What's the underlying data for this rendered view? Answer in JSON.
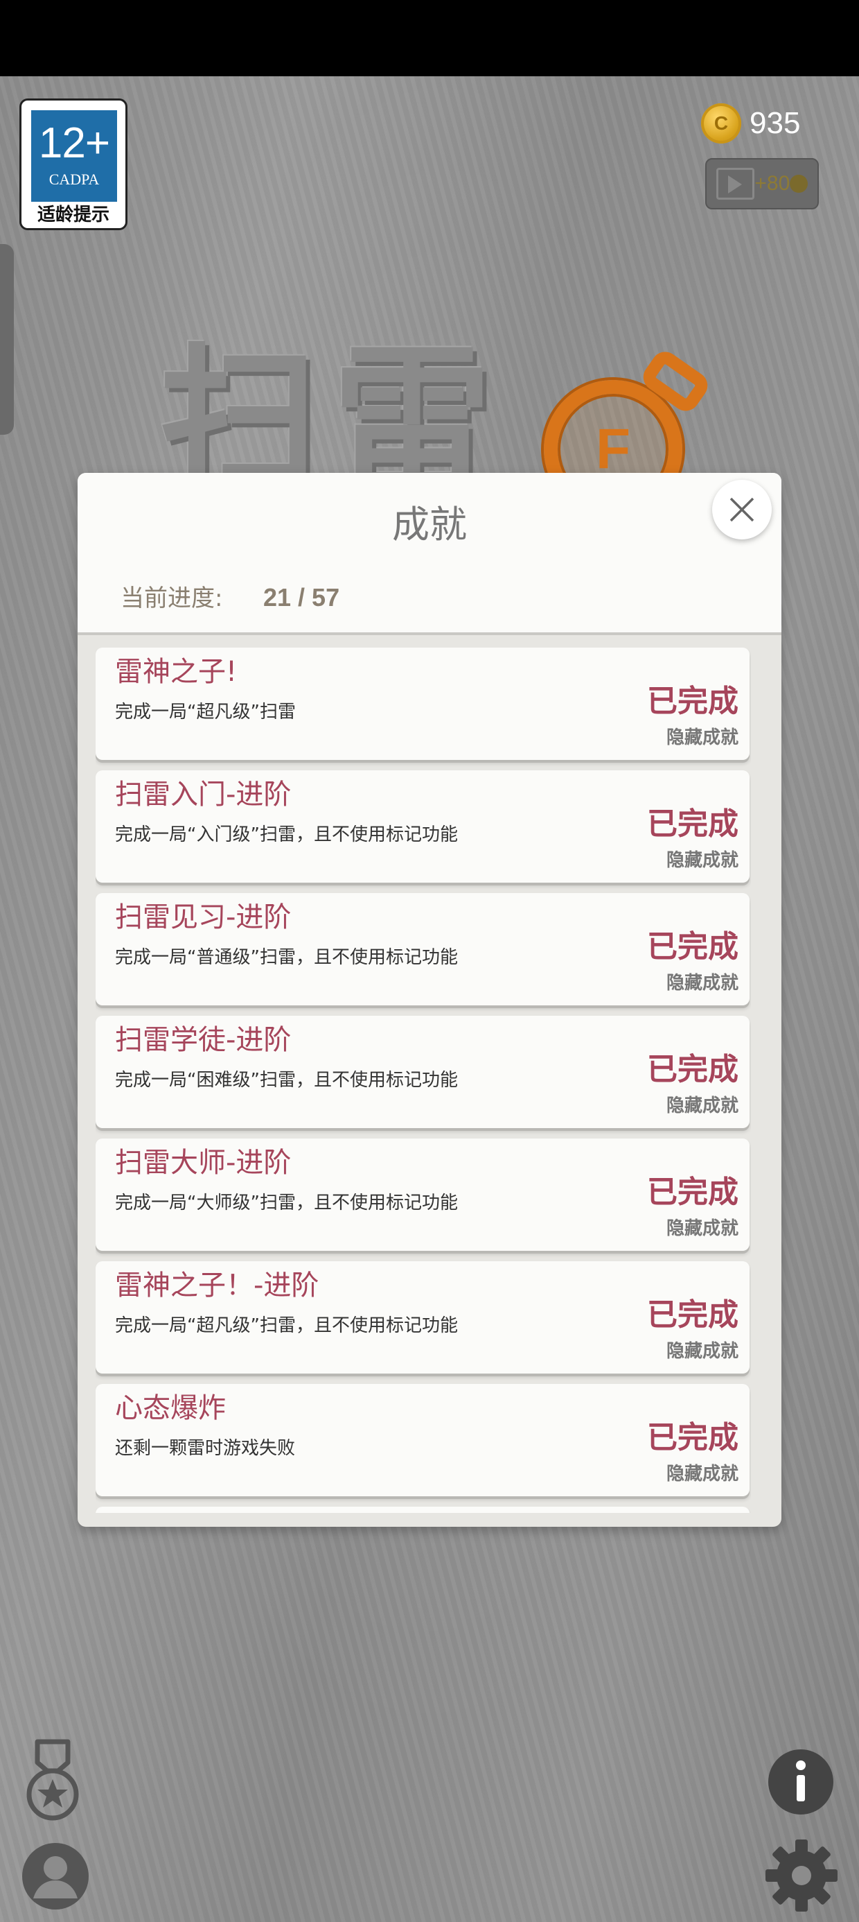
{
  "age_rating": {
    "age": "12+",
    "org": "CADPA",
    "tip": "适龄提示"
  },
  "wallet": {
    "coin_symbol": "C",
    "coins": "935",
    "video_reward": "+80"
  },
  "logo": {
    "title": "扫雷",
    "bomb_letter": "F"
  },
  "dialog": {
    "title": "成就",
    "progress_label": "当前进度:",
    "progress_value": "21 / 57",
    "achievements": [
      {
        "name": "雷神之子!",
        "desc": "完成一局“超凡级”扫雷",
        "status": "已完成",
        "tag": "隐藏成就"
      },
      {
        "name": "扫雷入门-进阶",
        "desc": "完成一局“入门级”扫雷，且不使用标记功能",
        "status": "已完成",
        "tag": "隐藏成就"
      },
      {
        "name": "扫雷见习-进阶",
        "desc": "完成一局“普通级”扫雷，且不使用标记功能",
        "status": "已完成",
        "tag": "隐藏成就"
      },
      {
        "name": "扫雷学徒-进阶",
        "desc": "完成一局“困难级”扫雷，且不使用标记功能",
        "status": "已完成",
        "tag": "隐藏成就"
      },
      {
        "name": "扫雷大师-进阶",
        "desc": "完成一局“大师级”扫雷，且不使用标记功能",
        "status": "已完成",
        "tag": "隐藏成就"
      },
      {
        "name": "雷神之子！-进阶",
        "desc": "完成一局“超凡级”扫雷，且不使用标记功能",
        "status": "已完成",
        "tag": "隐藏成就"
      },
      {
        "name": "心态爆炸",
        "desc": "还剩一颗雷时游戏失败",
        "status": "已完成",
        "tag": "隐藏成就"
      }
    ]
  },
  "colors": {
    "accent": "#a6455b",
    "progress_text": "#8a7f70"
  }
}
